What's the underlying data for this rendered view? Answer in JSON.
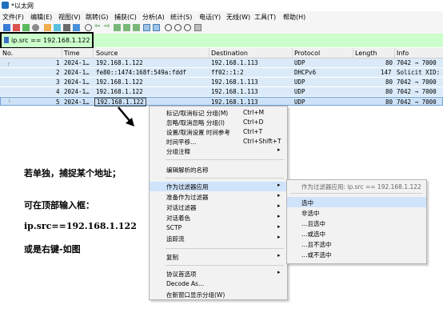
{
  "window": {
    "title": "*以太网"
  },
  "menu": [
    "文件(F)",
    "编辑(E)",
    "视图(V)",
    "跳转(G)",
    "捕获(C)",
    "分析(A)",
    "统计(S)",
    "电话(Y)",
    "无线(W)",
    "工具(T)",
    "帮助(H)"
  ],
  "filter": {
    "value": "ip.src == 192.168.1.122"
  },
  "columns": [
    "No.",
    "Time",
    "Source",
    "Destination",
    "Protocol",
    "Length",
    "Info"
  ],
  "packets": [
    {
      "no": "1",
      "time": "2024-1…",
      "source": "192.168.1.122",
      "destination": "192.168.1.113",
      "protocol": "UDP",
      "length": "80",
      "info": "7042 → 7000"
    },
    {
      "no": "2",
      "time": "2024-1…",
      "source": "fe80::1474:168f:549a:fddf",
      "destination": "ff02::1:2",
      "protocol": "DHCPv6",
      "length": "147",
      "info": "Solicit XID:"
    },
    {
      "no": "3",
      "time": "2024-1…",
      "source": "192.168.1.122",
      "destination": "192.168.1.113",
      "protocol": "UDP",
      "length": "80",
      "info": "7042 → 7000"
    },
    {
      "no": "4",
      "time": "2024-1…",
      "source": "192.168.1.122",
      "destination": "192.168.1.113",
      "protocol": "UDP",
      "length": "80",
      "info": "7042 → 7000"
    },
    {
      "no": "5",
      "time": "2024-1…",
      "source": "192.168.1.122",
      "destination": "192.168.1.113",
      "protocol": "UDP",
      "length": "80",
      "info": "7042 → 7000"
    }
  ],
  "context_menu": {
    "items": [
      {
        "label": "标记/取消标记 分组(M)",
        "shortcut": "Ctrl+M"
      },
      {
        "label": "忽略/取消忽略 分组(I)",
        "shortcut": "Ctrl+D"
      },
      {
        "label": "设置/取消设置 时间参考",
        "shortcut": "Ctrl+T"
      },
      {
        "label": "时间平移…",
        "shortcut": "Ctrl+Shift+T"
      },
      {
        "label": "分组注释",
        "shortcut": ""
      },
      {
        "label": "编辑解析的名称",
        "shortcut": ""
      },
      {
        "label": "作为过滤器应用",
        "shortcut": ""
      },
      {
        "label": "准备作为过滤器",
        "shortcut": ""
      },
      {
        "label": "对话过滤器",
        "shortcut": ""
      },
      {
        "label": "对话着色",
        "shortcut": ""
      },
      {
        "label": "SCTP",
        "shortcut": ""
      },
      {
        "label": "追踪流",
        "shortcut": ""
      },
      {
        "label": "复制",
        "shortcut": ""
      },
      {
        "label": "协议首选项",
        "shortcut": ""
      },
      {
        "label": "Decode As…",
        "shortcut": ""
      },
      {
        "label": "在新窗口显示分组(W)",
        "shortcut": ""
      }
    ]
  },
  "submenu": {
    "header": "作为过滤器应用: ip.src == 192.168.1.122",
    "items": [
      "选中",
      "非选中",
      "…且选中",
      "…或选中",
      "…且不选中",
      "…或不选中"
    ]
  },
  "notes": {
    "line1": "若单独，捕捉某个地址；",
    "line2": "可在顶部输入框：",
    "line3": "ip.src==192.168.1.122",
    "line4": "或是右键-如图"
  },
  "colors": {
    "filter_bg": "#ccffcc",
    "row_bg": "#dbeaf8",
    "highlight": "#cfe3fb",
    "arrow": "#000000"
  }
}
